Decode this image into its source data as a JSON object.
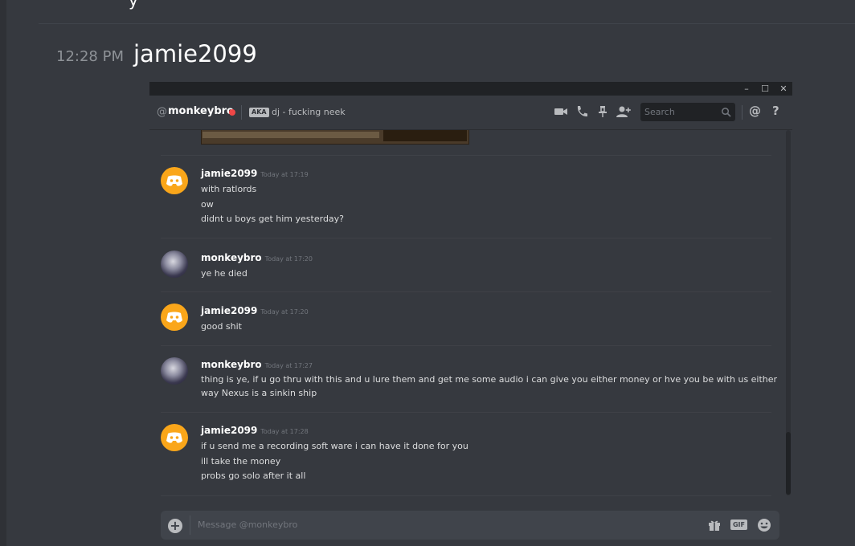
{
  "outer": {
    "timestamp": "12:28 PM",
    "username": "jamie2099",
    "top_fragment": "y"
  },
  "window": {
    "minimize": "–",
    "maximize": "☐",
    "close": "✕"
  },
  "header": {
    "at_symbol": "@",
    "channel": "monkeybro",
    "aka": "AKA",
    "nickname": "dj - fucking neek",
    "search_placeholder": "Search",
    "mention_btn": "@",
    "help_btn": "?",
    "status_color": "#f04747"
  },
  "messages": [
    {
      "author": "jamie2099",
      "avatar": "discord-default",
      "time": "Today at 17:19",
      "lines": [
        "with ratlords",
        "ow",
        "didnt u boys get him yesterday?"
      ]
    },
    {
      "author": "monkeybro",
      "avatar": "photo",
      "time": "Today at 17:20",
      "lines": [
        "ye he died"
      ]
    },
    {
      "author": "jamie2099",
      "avatar": "discord-default",
      "time": "Today at 17:20",
      "lines": [
        "good shit"
      ]
    },
    {
      "author": "monkeybro",
      "avatar": "photo",
      "time": "Today at 17:27",
      "lines": [
        "thing is ye, if  u go thru with this and u lure them and get me some audio i can give you either money or hve you be with us either",
        "way Nexus is a sinkin ship"
      ]
    },
    {
      "author": "jamie2099",
      "avatar": "discord-default",
      "time": "Today at 17:28",
      "lines": [
        "if u send me a recording soft ware i can have it done for you",
        "ill take the money",
        "probs go solo after it all"
      ]
    }
  ],
  "composer": {
    "placeholder": "Message @monkeybro",
    "plus": "+",
    "gif": "GIF"
  },
  "colors": {
    "background": "#36393f",
    "discord_avatar": "#faa61a",
    "username": "#ffffff",
    "timestamp": "#72767d"
  }
}
